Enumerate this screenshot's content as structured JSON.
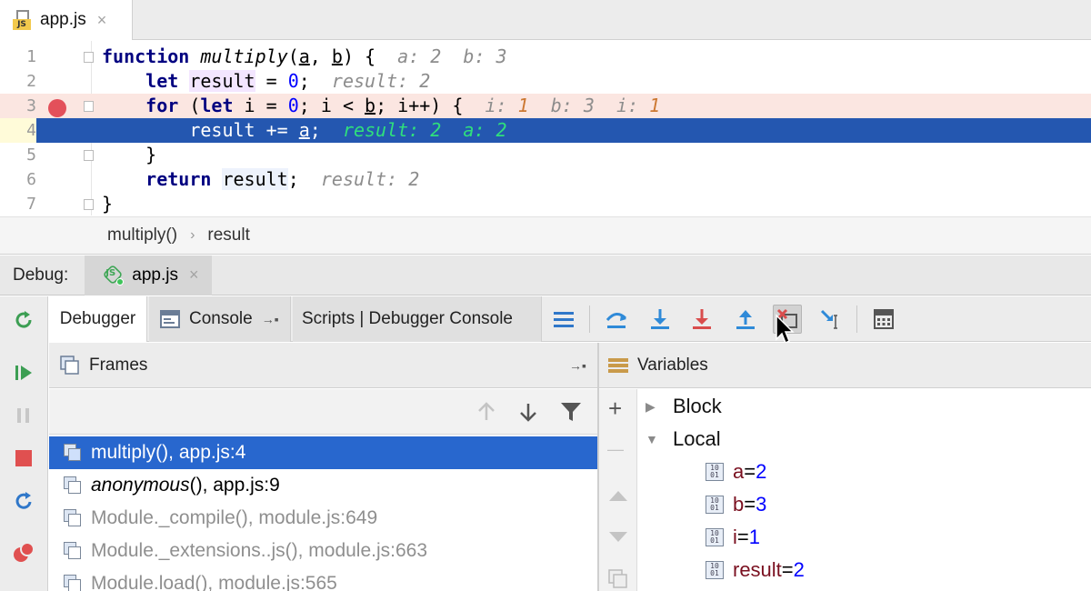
{
  "editor_tab": {
    "label": "app.js",
    "close": "×"
  },
  "code": {
    "lines": [
      {
        "n": "1"
      },
      {
        "n": "2"
      },
      {
        "n": "3"
      },
      {
        "n": "4"
      },
      {
        "n": "5"
      },
      {
        "n": "6"
      },
      {
        "n": "7"
      }
    ],
    "l1": {
      "kw": "function",
      "fn": "multiply",
      "p_open": "(",
      "a": "a",
      "comma": ", ",
      "b": "b",
      "rest": ") {",
      "inlay": "a: 2  b: 3"
    },
    "l2": {
      "kw": "let",
      "var": "result",
      "eq": " = ",
      "num": "0",
      "semi": ";",
      "inlay": "result: 2"
    },
    "l3": {
      "kw1": "for",
      "p1": " (",
      "kw2": "let",
      "mid1": " i = ",
      "num": "0",
      "mid2": "; i < ",
      "b": "b",
      "mid3": "; i++) {",
      "inlay_i": "i: ",
      "inlay_i_v": "1",
      "inlay_b": "b: 3",
      "inlay_i2": "i: ",
      "inlay_i2_v": "1"
    },
    "l4": {
      "pre": "result += ",
      "a": "a",
      "semi": ";",
      "inlay": "result: 2  a: 2"
    },
    "l5": {
      "text": "}"
    },
    "l6": {
      "kw": "return",
      "var": "result",
      "semi": ";",
      "inlay": "result: 2"
    },
    "l7": {
      "text": "}"
    }
  },
  "breadcrumb": {
    "fn": "multiply()",
    "sep": "›",
    "var": "result"
  },
  "debug": {
    "label": "Debug:",
    "session_tab": "app.js",
    "session_close": "×",
    "tabs": {
      "debugger": "Debugger",
      "console": "Console",
      "console_pin": "→▪",
      "scripts": "Scripts | Debugger Console"
    }
  },
  "frames": {
    "title": "Frames",
    "pin": "→▪",
    "items": [
      {
        "label": "multiply(), app.js:4"
      },
      {
        "label_em": "anonymous",
        "label_rest": "(), app.js:9"
      },
      {
        "label": "Module._compile(), module.js:649"
      },
      {
        "label": "Module._extensions..js(), module.js:663"
      },
      {
        "label": "Module.load(), module.js:565"
      }
    ]
  },
  "variables": {
    "title": "Variables",
    "groups": {
      "block": "Block",
      "local": "Local"
    },
    "items": [
      {
        "name": "a",
        "eq": " = ",
        "value": "2"
      },
      {
        "name": "b",
        "eq": " = ",
        "value": "3"
      },
      {
        "name": "i",
        "eq": " = ",
        "value": "1"
      },
      {
        "name": "result",
        "eq": " = ",
        "value": "2"
      }
    ],
    "prim_icon_text": "10 01",
    "add": "+",
    "remove": "—"
  },
  "colors": {
    "current_line": "#2457b0",
    "breakpoint": "#e3505a",
    "selected_frame": "#2867ce",
    "inlay_value": "#cc7832",
    "inlay_current": "#2fe07c"
  }
}
